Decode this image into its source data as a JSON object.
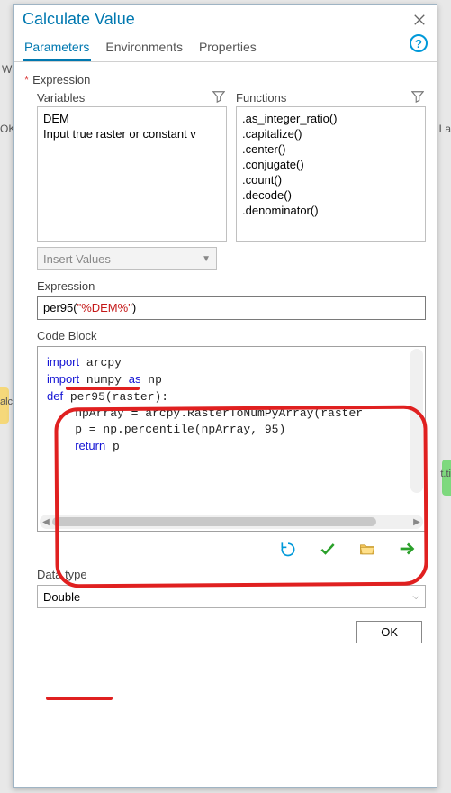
{
  "dialog": {
    "title": "Calculate Value"
  },
  "tabs": {
    "items": [
      {
        "label": "Parameters"
      },
      {
        "label": "Environments"
      },
      {
        "label": "Properties"
      }
    ],
    "active_index": 0
  },
  "expression_section": {
    "label": "Expression"
  },
  "variables": {
    "header": "Variables",
    "items": [
      "DEM",
      "Input true raster or constant v"
    ]
  },
  "functions": {
    "header": "Functions",
    "items": [
      ".as_integer_ratio()",
      ".capitalize()",
      ".center()",
      ".conjugate()",
      ".count()",
      ".decode()",
      ".denominator()"
    ]
  },
  "insert_values": {
    "placeholder": "Insert Values"
  },
  "expression_field": {
    "label": "Expression",
    "prefix": "per95(",
    "string": "\"%DEM%\"",
    "suffix": ")"
  },
  "codeblock": {
    "label": "Code Block",
    "lines": [
      {
        "indent": 0,
        "tokens": [
          {
            "t": "import",
            "k": true
          },
          {
            "t": " arcpy"
          }
        ]
      },
      {
        "indent": 0,
        "tokens": [
          {
            "t": "import",
            "k": true
          },
          {
            "t": " numpy "
          },
          {
            "t": "as",
            "k": true
          },
          {
            "t": " np"
          }
        ]
      },
      {
        "indent": 0,
        "tokens": [
          {
            "t": "def",
            "k": true
          },
          {
            "t": " per95(raster):"
          }
        ]
      },
      {
        "indent": 1,
        "tokens": [
          {
            "t": "npArray = arcpy.RasterToNumPyArray(raster"
          }
        ]
      },
      {
        "indent": 1,
        "tokens": [
          {
            "t": "p = np.percentile(npArray, 95)"
          }
        ]
      },
      {
        "indent": 1,
        "tokens": [
          {
            "t": "return",
            "k": true
          },
          {
            "t": " p"
          }
        ]
      }
    ]
  },
  "toolbar": {
    "icons": [
      "undo-icon",
      "check-icon",
      "folder-icon",
      "arrow-right-icon"
    ]
  },
  "datatype": {
    "label": "Data type",
    "value": "Double"
  },
  "buttons": {
    "ok": "OK"
  },
  "bg_fragments": {
    "left1": "W",
    "left2": "OK",
    "right1": "La",
    "right2": "t.ti",
    "left3": "alc"
  }
}
